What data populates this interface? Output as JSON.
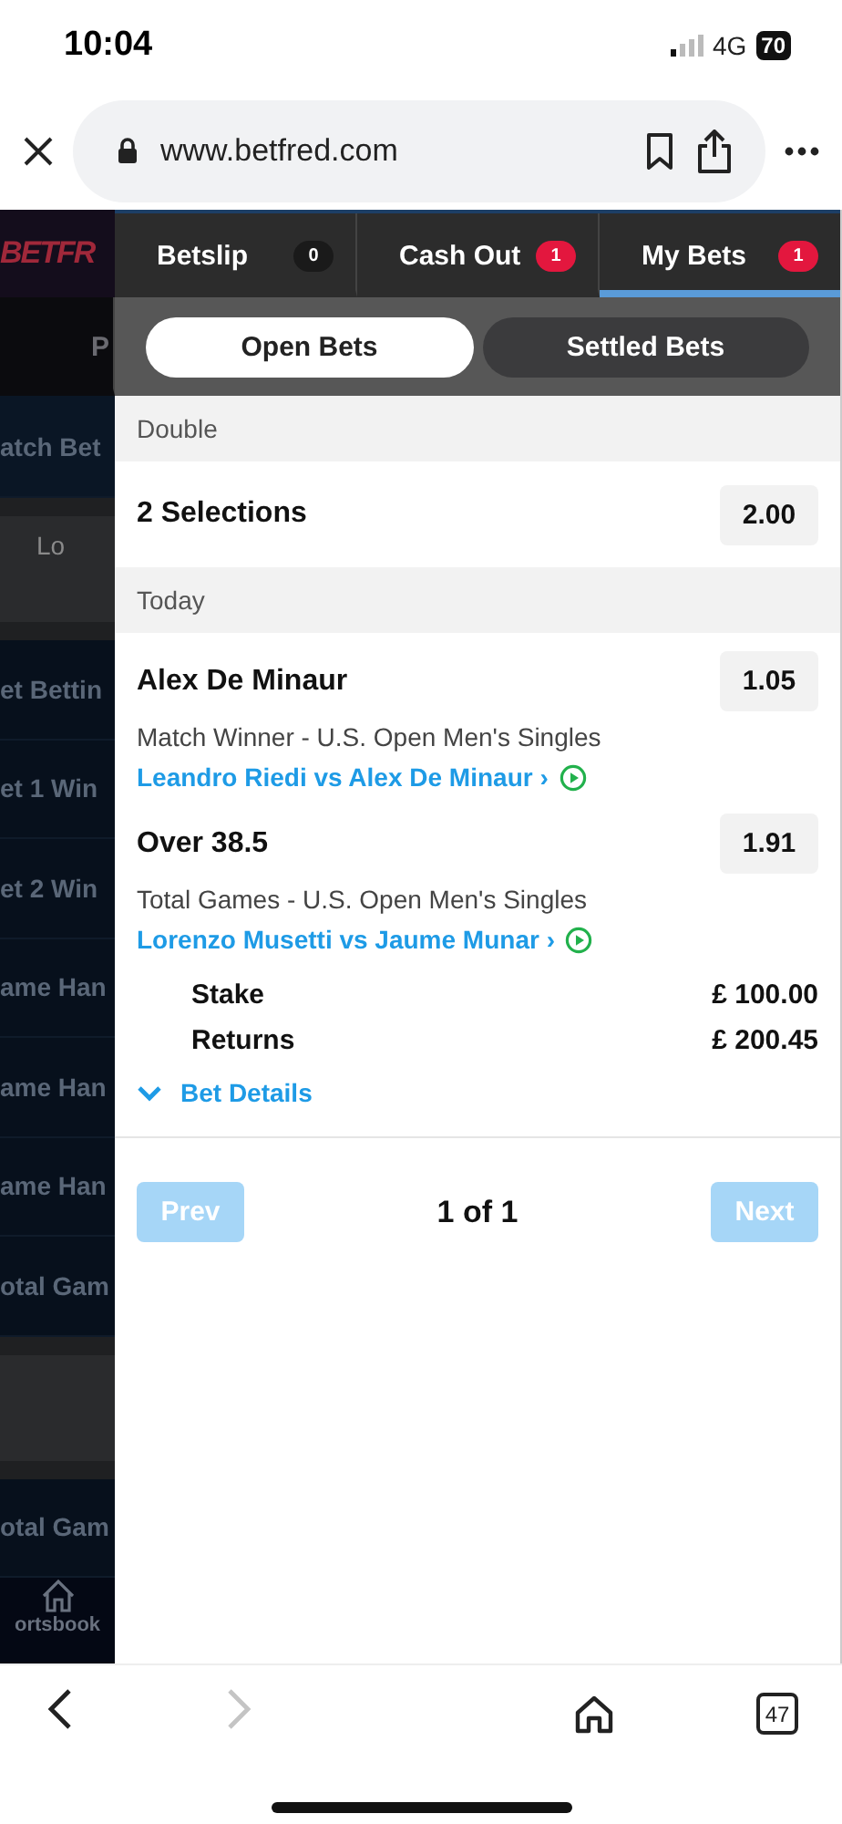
{
  "status_bar": {
    "time": "10:04",
    "network": "4G",
    "battery": "70"
  },
  "browser": {
    "url": "www.betfred.com"
  },
  "background_page": {
    "logo": "BETFR",
    "rows": [
      {
        "kind": "tab",
        "text": "P"
      },
      {
        "kind": "header",
        "text": "atch Bet"
      },
      {
        "kind": "filter",
        "text": "Lo"
      },
      {
        "kind": "market",
        "text": "et Bettin"
      },
      {
        "kind": "market",
        "text": "et 1 Win"
      },
      {
        "kind": "market",
        "text": "et 2 Win"
      },
      {
        "kind": "market",
        "text": "ame Han"
      },
      {
        "kind": "market",
        "text": "ame Han"
      },
      {
        "kind": "market",
        "text": "ame Han"
      },
      {
        "kind": "market",
        "text": "otal Gam"
      },
      {
        "kind": "filter",
        "text": ""
      },
      {
        "kind": "market",
        "text": "otal Gam"
      }
    ],
    "nav_label": "ortsbook"
  },
  "tabs": [
    {
      "label": "Betslip",
      "count": "0",
      "color": "#1a1a1a",
      "selected": false
    },
    {
      "label": "Cash Out",
      "count": "1",
      "color": "#e3173e",
      "selected": false
    },
    {
      "label": "My Bets",
      "count": "1",
      "color": "#e3173e",
      "selected": true
    }
  ],
  "segments": [
    {
      "label": "Open Bets",
      "selected": true
    },
    {
      "label": "Settled Bets",
      "selected": false
    }
  ],
  "bet": {
    "type": "Double",
    "summary": "2 Selections",
    "odds": "2.00",
    "date": "Today",
    "selections": [
      {
        "name": "Alex De Minaur",
        "odds": "1.05",
        "market": "Match Winner - U.S. Open Men's Singles",
        "event": "Leandro Riedi vs Alex De Minaur ›"
      },
      {
        "name": "Over 38.5",
        "odds": "1.91",
        "market": "Total Games - U.S. Open Men's Singles",
        "event": "Lorenzo Musetti vs Jaume Munar ›"
      }
    ],
    "stake_label": "Stake",
    "stake": "£ 100.00",
    "returns_label": "Returns",
    "returns": "£ 200.45",
    "details_label": "Bet Details",
    "expanded": false
  },
  "pager": {
    "prev": {
      "label": "Prev",
      "disabled": true
    },
    "position": "1 of 1",
    "next": {
      "label": "Next",
      "disabled": true
    }
  },
  "toolbar": {
    "nav": [
      {
        "kind": "back",
        "disabled": false
      },
      {
        "kind": "forward",
        "disabled": true
      }
    ],
    "tab_count": "47"
  }
}
